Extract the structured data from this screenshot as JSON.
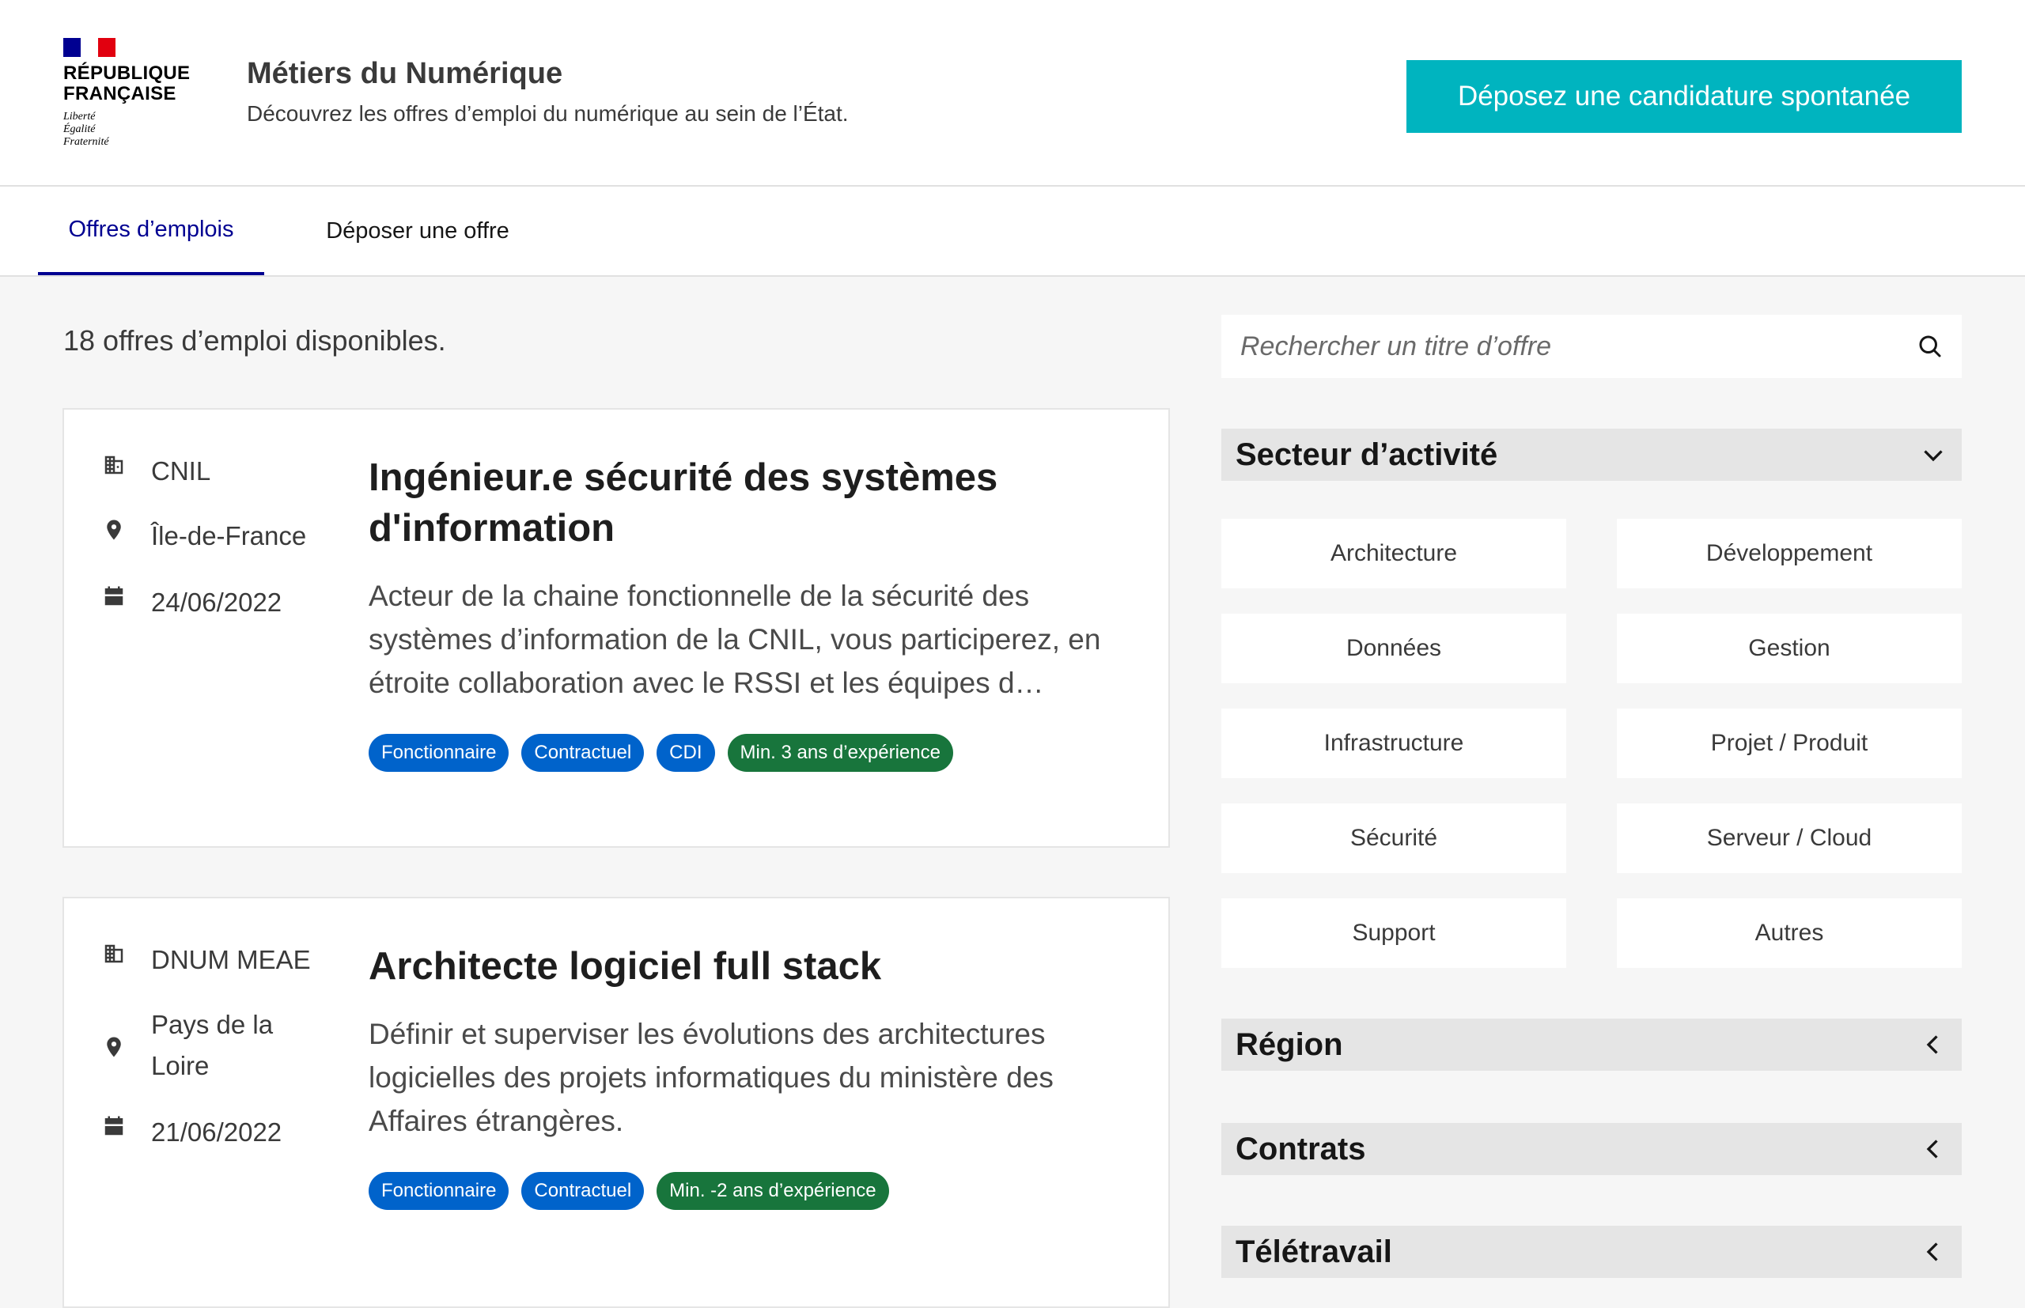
{
  "header": {
    "logo_name_line1": "RÉPUBLIQUE",
    "logo_name_line2": "FRANÇAISE",
    "logo_motto_1": "Liberté",
    "logo_motto_2": "Égalité",
    "logo_motto_3": "Fraternité",
    "site_title": "Métiers du Numérique",
    "site_tagline": "Découvrez les offres d’emploi du numérique au sein de l’État.",
    "cta_label": "Déposez une candidature spontanée",
    "colors": {
      "flag_blue": "#000091",
      "flag_red": "#e1000f",
      "cta": "#00b4bf"
    }
  },
  "nav": {
    "tabs": [
      {
        "label": "Offres d’emplois",
        "active": true
      },
      {
        "label": "Déposer une offre",
        "active": false
      }
    ]
  },
  "main": {
    "result_count": "18 offres d’emploi disponibles.",
    "offers": [
      {
        "organization": "CNIL",
        "region": "Île-de-France",
        "date": "24/06/2022",
        "title": "Ingénieur.e sécurité des systèmes d'information",
        "description": "Acteur de la chaine fonctionnelle de la sécurité des systèmes d’information de la CNIL, vous participerez, en étroite collaboration avec le RSSI et les équipes d…",
        "tags": [
          {
            "label": "Fonctionnaire",
            "color": "blue"
          },
          {
            "label": "Contractuel",
            "color": "blue"
          },
          {
            "label": "CDI",
            "color": "blue"
          },
          {
            "label": "Min. 3 ans d’expérience",
            "color": "green"
          }
        ]
      },
      {
        "organization": "DNUM MEAE",
        "region": "Pays de la Loire",
        "date": "21/06/2022",
        "title": "Architecte logiciel full stack",
        "description": "Définir et superviser les évolutions des architectures logicielles des projets informatiques du ministère des Affaires étrangères.",
        "tags": [
          {
            "label": "Fonctionnaire",
            "color": "blue"
          },
          {
            "label": "Contractuel",
            "color": "blue"
          },
          {
            "label": "Min. -2 ans d’expérience",
            "color": "green"
          }
        ]
      }
    ],
    "icons": {
      "organization": "building-icon",
      "region": "map-pin-icon",
      "date": "calendar-icon"
    }
  },
  "sidebar": {
    "search": {
      "placeholder": "Rechercher un titre d’offre",
      "value": ""
    },
    "filters": {
      "sector": {
        "label": "Secteur d’activité",
        "state": "expanded"
      },
      "sector_options": [
        "Architecture",
        "Développement",
        "Données",
        "Gestion",
        "Infrastructure",
        "Projet / Produit",
        "Sécurité",
        "Serveur / Cloud",
        "Support",
        "Autres"
      ],
      "region": {
        "label": "Région",
        "state": "collapsed"
      },
      "contracts": {
        "label": "Contrats",
        "state": "collapsed"
      },
      "remote": {
        "label": "Télétravail",
        "state": "collapsed"
      }
    }
  }
}
